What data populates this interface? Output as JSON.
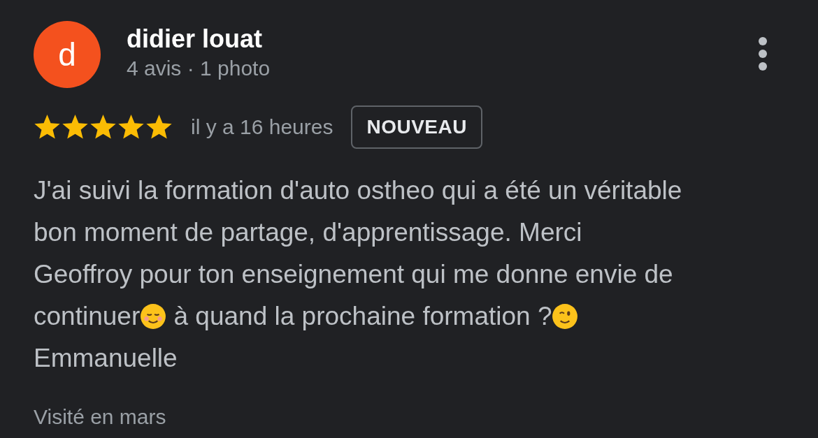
{
  "review": {
    "author": "didier louat",
    "avatar_letter": "d",
    "meta": "4 avis · 1 photo",
    "stars": 5,
    "time": "il y a 16 heures",
    "badge": "NOUVEAU",
    "lines": [
      [
        {
          "kind": "text",
          "text": "J'ai suivi la formation d'auto ostheo qui a été un véritable"
        }
      ],
      [
        {
          "kind": "text",
          "text": "bon moment de partage, d'apprentissage. Merci"
        }
      ],
      [
        {
          "kind": "text",
          "text": "Geoffroy pour ton enseignement qui me donne envie de"
        }
      ],
      [
        {
          "kind": "text",
          "text": "continuer"
        },
        {
          "kind": "smile"
        },
        {
          "kind": "text",
          "text": " à quand la prochaine formation ?"
        },
        {
          "kind": "wink"
        }
      ],
      [
        {
          "kind": "text",
          "text": "Emmanuelle"
        }
      ]
    ],
    "visited": "Visité en mars"
  }
}
